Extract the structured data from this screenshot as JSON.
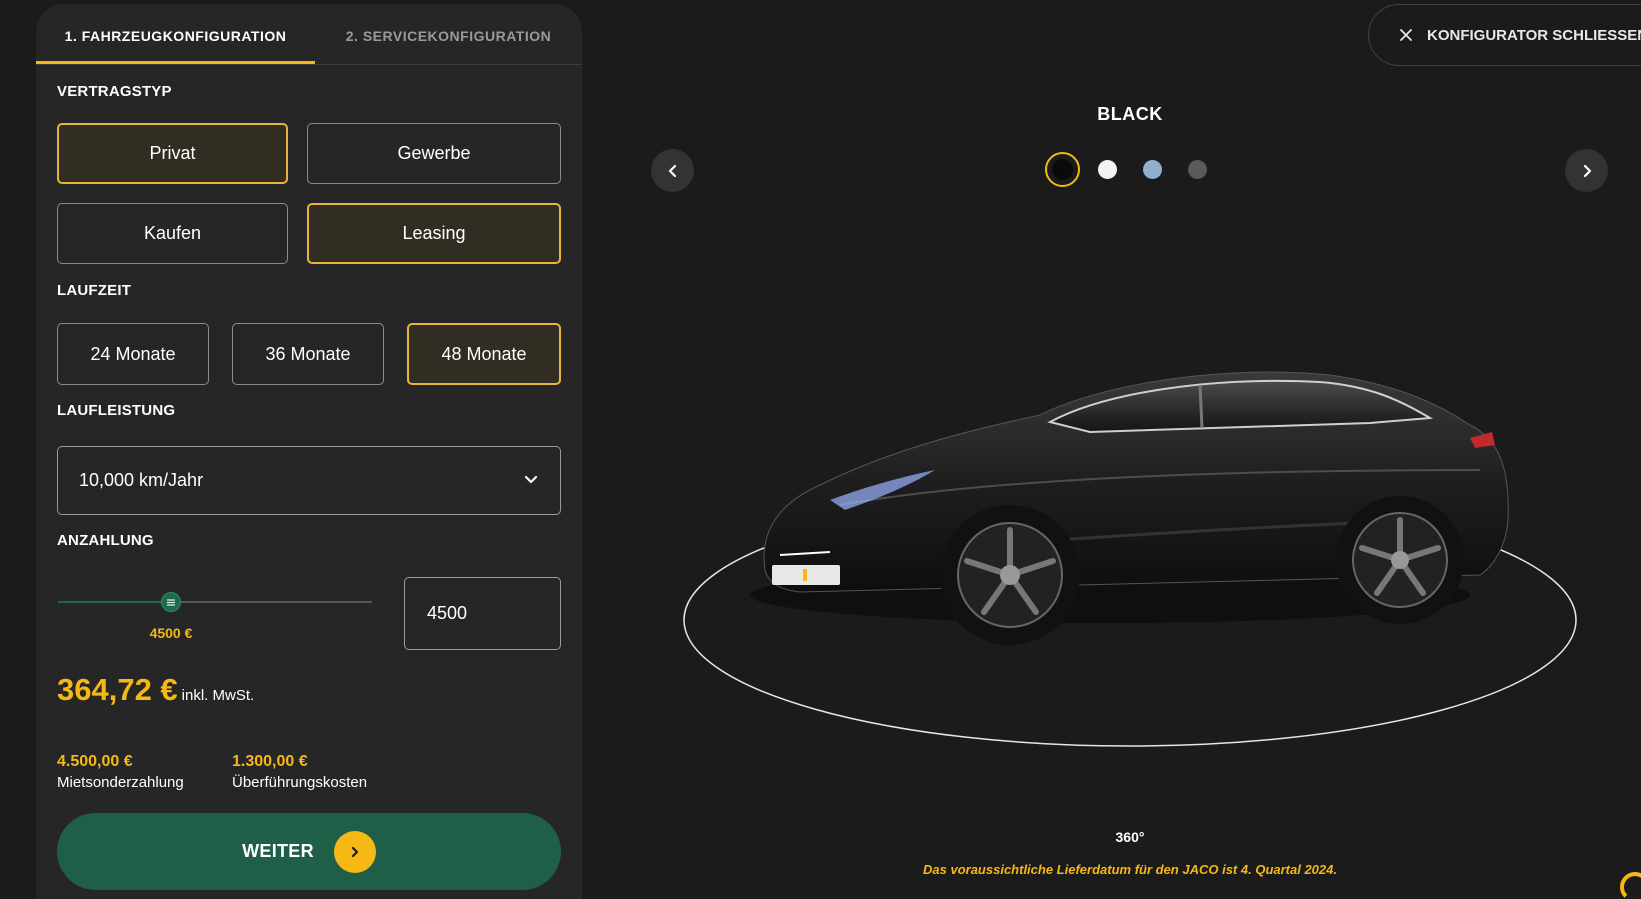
{
  "tabs": [
    {
      "label": "1. FAHRZEUGKONFIGURATION",
      "active": true
    },
    {
      "label": "2. SERVICEKONFIGURATION",
      "active": false
    }
  ],
  "vertragstyp": {
    "label": "VERTRAGSTYP",
    "customer_options": [
      {
        "label": "Privat",
        "selected": true
      },
      {
        "label": "Gewerbe",
        "selected": false
      }
    ],
    "purchase_options": [
      {
        "label": "Kaufen",
        "selected": false
      },
      {
        "label": "Leasing",
        "selected": true
      }
    ]
  },
  "laufzeit": {
    "label": "LAUFZEIT",
    "options": [
      {
        "label": "24 Monate",
        "selected": false
      },
      {
        "label": "36 Monate",
        "selected": false
      },
      {
        "label": "48 Monate",
        "selected": true
      }
    ]
  },
  "laufleistung": {
    "label": "LAUFLEISTUNG",
    "selected": "10,000 km/Jahr"
  },
  "anzahlung": {
    "label": "ANZAHLUNG",
    "slider_fraction": 0.36,
    "slider_value_label": "4500 €",
    "input_value": "4500"
  },
  "price": {
    "amount": "364,72 €",
    "note": "inkl. MwSt."
  },
  "costs": [
    {
      "amount": "4.500,00 €",
      "label": "Mietsonderzahlung"
    },
    {
      "amount": "1.300,00 €",
      "label": "Überführungskosten"
    }
  ],
  "weiter_label": "WEITER",
  "close_label": "KONFIGURATOR SCHLIESSEN",
  "color_name": "BLACK",
  "swatches": [
    {
      "color": "#0a0a0a",
      "selected": true
    },
    {
      "color": "#f2f2f2",
      "selected": false
    },
    {
      "color": "#8fb0cc",
      "selected": false
    },
    {
      "color": "#5a5a5a",
      "selected": false
    }
  ],
  "view_label": "360°",
  "delivery_note": "Das voraussichtliche Lieferdatum für den JACO ist 4. Quartal 2024.",
  "colors": {
    "accent": "#f5b814",
    "primary_button": "#1f5e47",
    "selected_border": "#e5b53b"
  }
}
